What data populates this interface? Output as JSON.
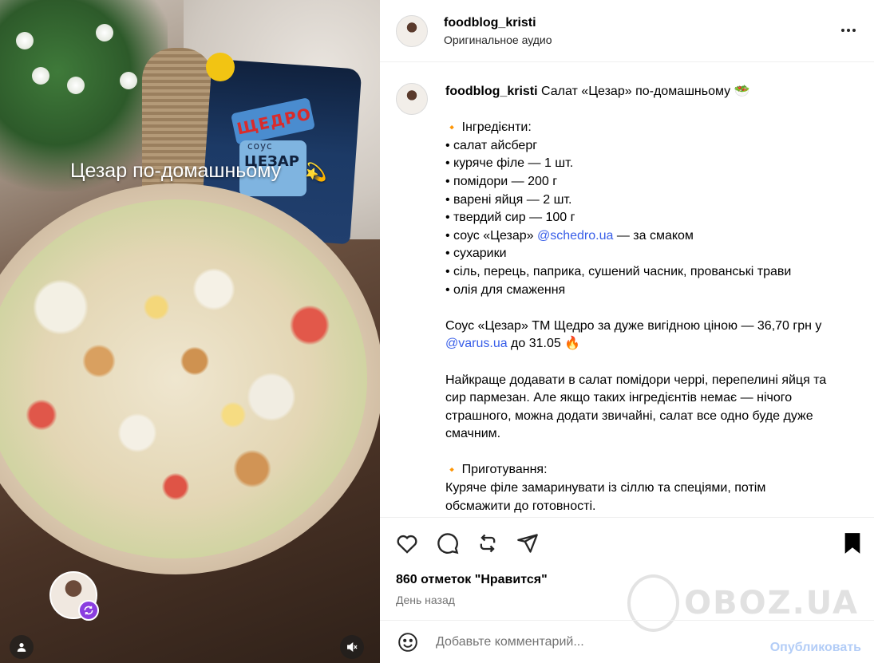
{
  "media": {
    "overlay_title": "Цезар по-домашньому",
    "overlay_emoji": "💫",
    "sauce_brand": "ЩЕДРО",
    "sauce_word": "соус",
    "sauce_name": "ЦЕЗАР"
  },
  "header": {
    "username": "foodblog_kristi",
    "audio": "Оригинальное аудио"
  },
  "caption": {
    "username": "foodblog_kristi",
    "title": "Салат «Цезар» по-домашньому 🥗",
    "ingredients_heading": "Інгредієнти:",
    "ingredients": [
      "• салат айсберг",
      "• куряче філе — 1 шт.",
      "• помідори — 200 г",
      "• варені яйця — 2 шт.",
      "• твердий сир — 100 г"
    ],
    "sauce_line_prefix": "• соус «Цезар» ",
    "sauce_line_link": "@schedro.ua",
    "sauce_line_suffix": " — за смаком",
    "ingredients_rest": [
      "• сухарики",
      "• сіль, перець, паприка, сушений часник, прованські трави",
      "• олія для смаження"
    ],
    "promo_line1": "Соус «Цезар» ТМ Щедро за дуже вигідною ціною — 36,70 грн у",
    "promo_link": "@varus.ua",
    "promo_suffix": " до 31.05 🔥",
    "tip_lines": [
      "Найкраще додавати в салат помідори черрі, перепелині яйця та",
      "сир пармезан. Але якщо таких інгредієнтів немає — нічого",
      "страшного, можна додати звичайні, салат все одно буде дуже",
      "смачним."
    ],
    "prep_heading": "Приготування:",
    "prep_lines": [
      "Куряче філе замаринувати із сіллю та спеціями, потім",
      "обсмажити до готовності."
    ]
  },
  "footer": {
    "likes": "860 отметок \"Нравится\"",
    "time": "День назад",
    "comment_placeholder": "Добавьте комментарий...",
    "post_label": "Опубликовать"
  },
  "watermark": "OBOZ.UA",
  "colors": {
    "link": "#385ee8",
    "post_disabled": "#b3cdf7",
    "accent_diamond": "#e2643b"
  }
}
